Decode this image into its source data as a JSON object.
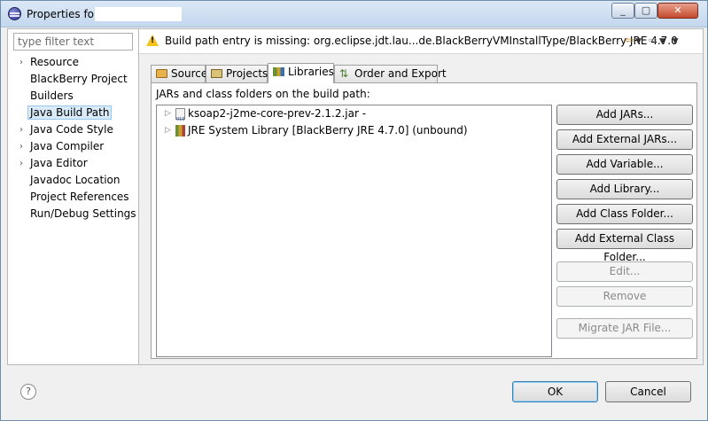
{
  "window": {
    "title": "Properties for",
    "minimize": "_",
    "maximize": "▢",
    "close": "✕"
  },
  "sidebar": {
    "filter_placeholder": "type filter text",
    "items": [
      {
        "label": "Resource",
        "expandable": true
      },
      {
        "label": "BlackBerry Project",
        "expandable": false
      },
      {
        "label": "Builders",
        "expandable": false
      },
      {
        "label": "Java Build Path",
        "expandable": false,
        "selected": true
      },
      {
        "label": "Java Code Style",
        "expandable": true
      },
      {
        "label": "Java Compiler",
        "expandable": true
      },
      {
        "label": "Java Editor",
        "expandable": true
      },
      {
        "label": "Javadoc Location",
        "expandable": false
      },
      {
        "label": "Project References",
        "expandable": false
      },
      {
        "label": "Run/Debug Settings",
        "expandable": false
      }
    ]
  },
  "message": {
    "text": "Build path entry is missing: org.eclipse.jdt.lau...de.BlackBerryVMInstallType/BlackBerry JRE 4.7.0"
  },
  "tabs": [
    {
      "label": "Source"
    },
    {
      "label": "Projects"
    },
    {
      "label": "Libraries",
      "active": true
    },
    {
      "label": "Order and Export"
    }
  ],
  "libraries": {
    "list_label": "JARs and class folders on the build path:",
    "entries": [
      {
        "label": "ksoap2-j2me-core-prev-2.1.2.jar -"
      },
      {
        "label": "JRE System Library [BlackBerry JRE 4.7.0] (unbound)"
      }
    ],
    "buttons": {
      "add_jars": "Add JARs...",
      "add_external_jars": "Add External JARs...",
      "add_variable": "Add Variable...",
      "add_library": "Add Library...",
      "add_class_folder": "Add Class Folder...",
      "add_external_class_folder": "Add External Class Folder...",
      "edit": "Edit...",
      "remove": "Remove",
      "migrate_jar": "Migrate JAR File..."
    }
  },
  "footer": {
    "help": "?",
    "ok": "OK",
    "cancel": "Cancel"
  }
}
